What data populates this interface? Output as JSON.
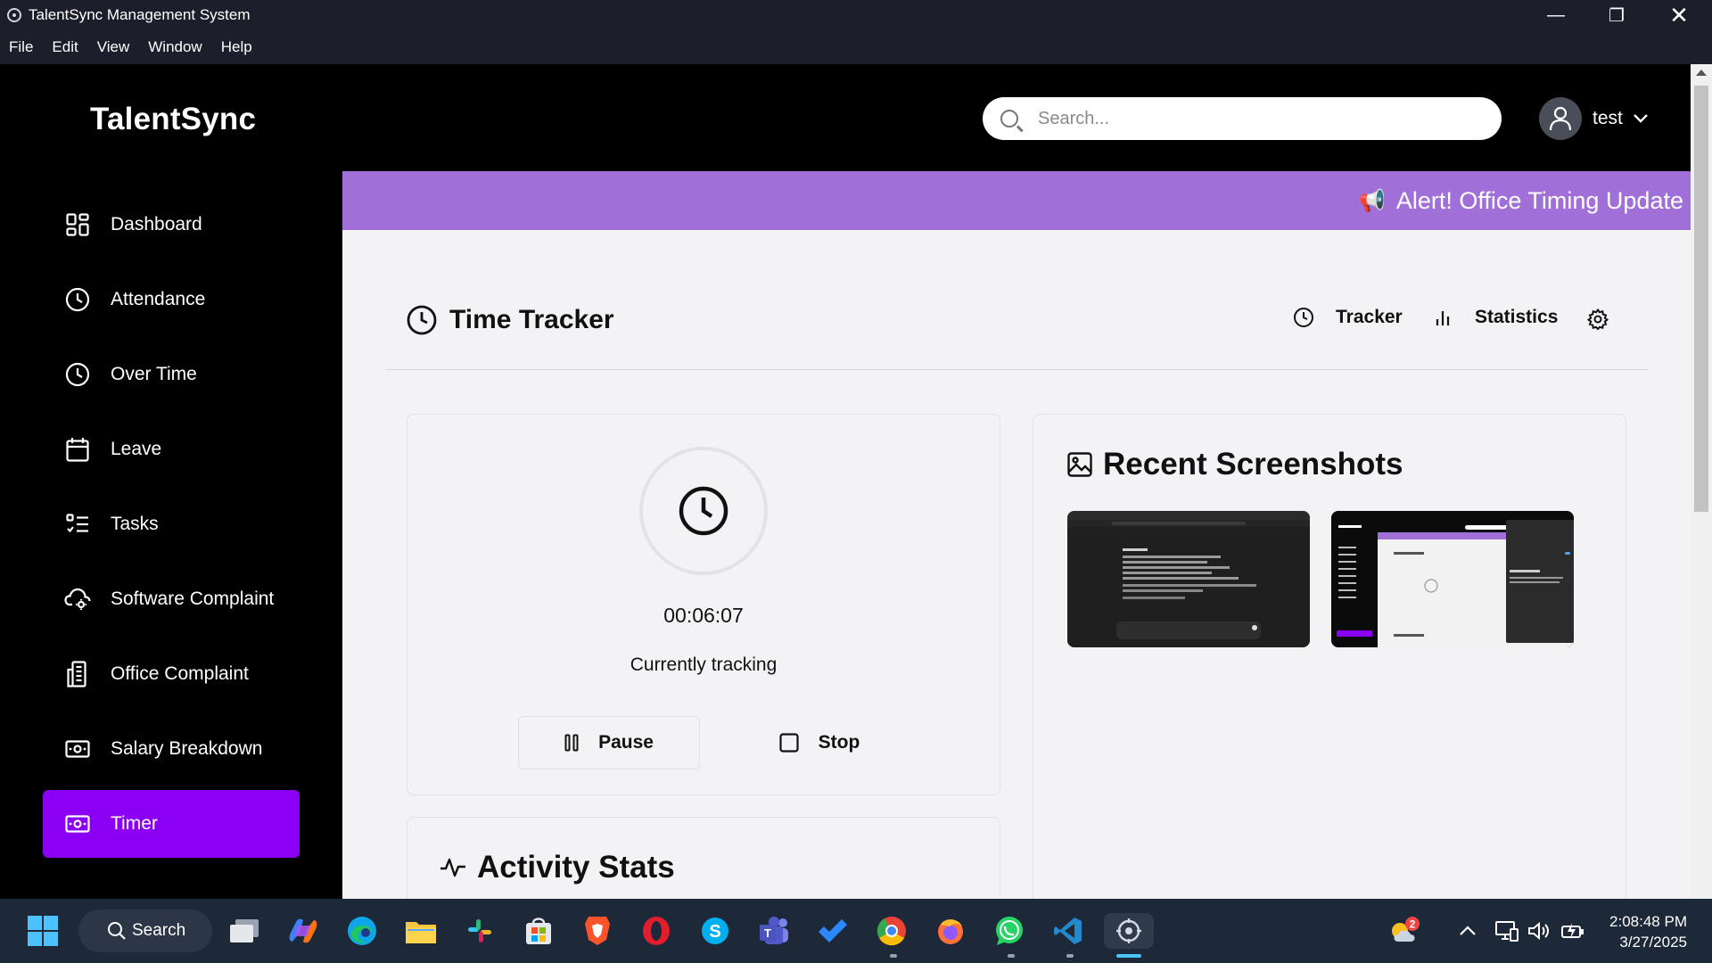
{
  "window": {
    "title": "TalentSync Management System",
    "minimize_glyph": "—",
    "maximize_glyph": "❐",
    "close_glyph": "✕"
  },
  "menu": [
    "File",
    "Edit",
    "View",
    "Window",
    "Help"
  ],
  "header": {
    "brand": "TalentSync",
    "search_placeholder": "Search...",
    "username": "test"
  },
  "sidebar": {
    "items": [
      {
        "label": "Dashboard",
        "icon": "dashboard-icon"
      },
      {
        "label": "Attendance",
        "icon": "clock-icon"
      },
      {
        "label": "Over Time",
        "icon": "clock-icon"
      },
      {
        "label": "Leave",
        "icon": "calendar-icon"
      },
      {
        "label": "Tasks",
        "icon": "list-icon"
      },
      {
        "label": "Software Complaint",
        "icon": "cloud-gear-icon"
      },
      {
        "label": "Office Complaint",
        "icon": "building-icon"
      },
      {
        "label": "Salary Breakdown",
        "icon": "money-icon"
      },
      {
        "label": "Timer",
        "icon": "timer-icon",
        "active": true
      }
    ]
  },
  "alert": {
    "text": "Alert! Office Timing Update",
    "icon": "megaphone-icon",
    "glyph": "📢"
  },
  "tracker": {
    "title": "Time Tracker",
    "tabs": {
      "tracker": "Tracker",
      "statistics": "Statistics"
    },
    "elapsed": "00:06:07",
    "status": "Currently tracking",
    "pause_label": "Pause",
    "stop_label": "Stop"
  },
  "screenshots": {
    "title": "Recent Screenshots"
  },
  "activity": {
    "title": "Activity Stats"
  },
  "taskbar": {
    "search_label": "Search",
    "notification_count": "2",
    "time": "2:08:48 PM",
    "date": "3/27/2025"
  },
  "colors": {
    "accent": "#8b00f5",
    "alert_bar": "#a06fd8",
    "content_bg": "#f3f3f5",
    "sidebar_bg": "#000000",
    "titlebar_bg": "#1c1e2c",
    "taskbar_bg": "#1d2838"
  }
}
